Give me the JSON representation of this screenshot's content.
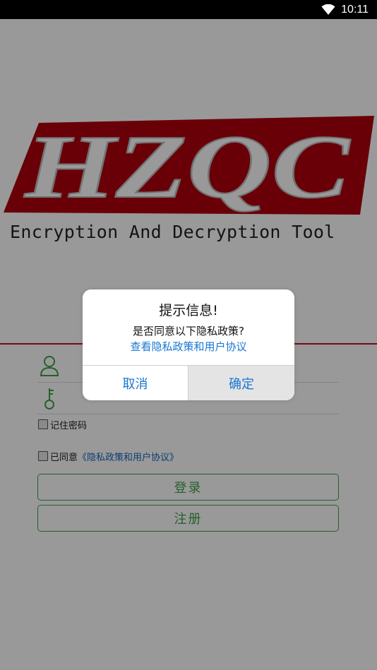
{
  "status_bar": {
    "time": "10:11",
    "wifi_icon": "wifi-icon"
  },
  "logo": {
    "text": "HZQC",
    "subtitle": "Encryption And Decryption Tool",
    "color": "#b0000e"
  },
  "form": {
    "username_icon": "user-icon",
    "password_icon": "key-icon",
    "username_value": "",
    "password_value": "",
    "remember_label": "记住密码",
    "agree_prefix": "已同意",
    "agree_link": "《隐私政策和用户协议》",
    "login_label": "登录",
    "register_label": "注册",
    "accent_color": "#3fa14a"
  },
  "dialog": {
    "title": "提示信息!",
    "message": "是否同意以下隐私政策?",
    "link": "查看隐私政策和用户协议",
    "cancel_label": "取消",
    "confirm_label": "确定"
  }
}
